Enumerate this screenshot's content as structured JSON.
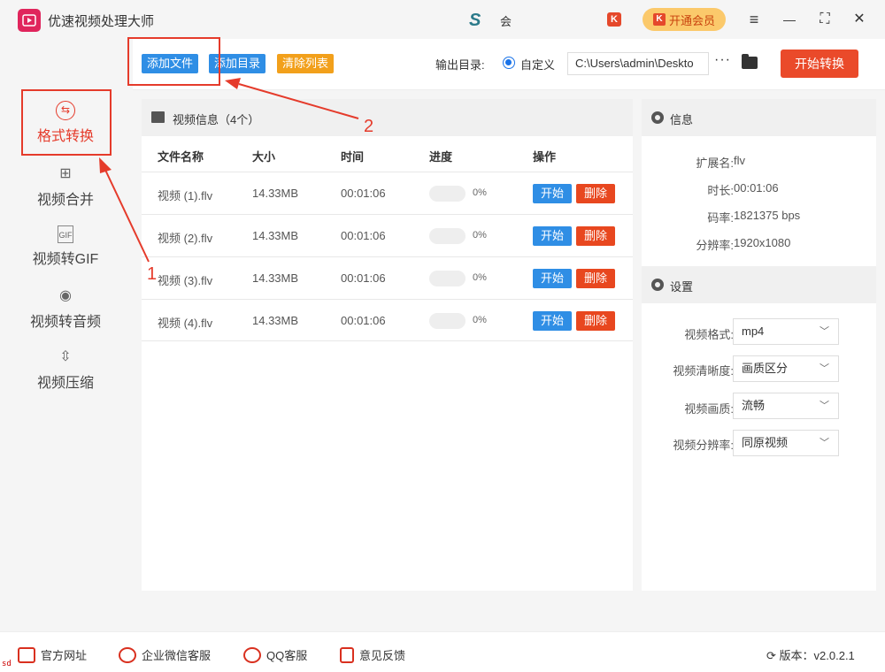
{
  "app": {
    "title": "优速视频处理大师"
  },
  "header": {
    "user_name": "会",
    "vip_label": "开通会员",
    "controls": {
      "menu": "≡",
      "minimize": "—",
      "maximize": "⛶",
      "close": "✕"
    }
  },
  "sidebar": {
    "items": [
      {
        "label": "格式转换",
        "icon": "convert-icon"
      },
      {
        "label": "视频合并",
        "icon": "merge-icon"
      },
      {
        "label": "视频转GIF",
        "icon": "gif-icon"
      },
      {
        "label": "视频转音频",
        "icon": "audio-icon"
      },
      {
        "label": "视频压缩",
        "icon": "compress-icon"
      }
    ]
  },
  "toolbar": {
    "add_file": "添加文件",
    "add_dir": "添加目录",
    "clear_list": "清除列表",
    "output_label": "输出目录:",
    "custom_label": "自定义",
    "output_path": "C:\\Users\\admin\\Deskto",
    "more": "···",
    "start_all": "开始转换"
  },
  "file_panel": {
    "title": "视频信息（4个）",
    "columns": [
      "文件名称",
      "大小",
      "时间",
      "进度",
      "操作"
    ],
    "rows": [
      {
        "name": "视频 (1).flv",
        "size": "14.33MB",
        "time": "00:01:06",
        "progress": 0,
        "progress_text": "0%",
        "start": "开始",
        "delete": "删除"
      },
      {
        "name": "视频 (2).flv",
        "size": "14.33MB",
        "time": "00:01:06",
        "progress": 0,
        "progress_text": "0%",
        "start": "开始",
        "delete": "删除"
      },
      {
        "name": "视频 (3).flv",
        "size": "14.33MB",
        "time": "00:01:06",
        "progress": 0,
        "progress_text": "0%",
        "start": "开始",
        "delete": "删除"
      },
      {
        "name": "视频 (4).flv",
        "size": "14.33MB",
        "time": "00:01:06",
        "progress": 0,
        "progress_text": "0%",
        "start": "开始",
        "delete": "删除"
      }
    ]
  },
  "info": {
    "title": "信息",
    "fields": [
      {
        "label": "扩展名:",
        "value": "flv"
      },
      {
        "label": "时长:",
        "value": "00:01:06"
      },
      {
        "label": "码率:",
        "value": "1821375 bps"
      },
      {
        "label": "分辨率:",
        "value": "1920x1080"
      }
    ]
  },
  "settings": {
    "title": "设置",
    "fields": [
      {
        "label": "视频格式:",
        "value": "mp4"
      },
      {
        "label": "视频清晰度:",
        "value": "画质区分"
      },
      {
        "label": "视频画质:",
        "value": "流畅"
      },
      {
        "label": "视频分辨率:",
        "value": "同原视频"
      }
    ]
  },
  "annotations": {
    "marker1": "1",
    "marker2": "2"
  },
  "footer": {
    "site": "官方网址",
    "wechat": "企业微信客服",
    "qq": "QQ客服",
    "feedback": "意见反馈",
    "version": "版本：v2.0.2.1"
  },
  "corner_text": "sd",
  "colors": {
    "accent_red": "#ea4a2a",
    "blue": "#1a73e8",
    "orange": "#f2a01b",
    "delete_red": "#e8471f"
  }
}
